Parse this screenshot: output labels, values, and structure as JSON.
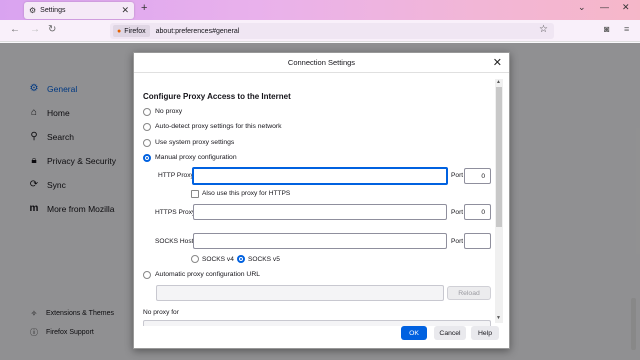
{
  "browser": {
    "tab_title": "Settings",
    "tab_icon": "gear-icon",
    "new_tab": "+",
    "identity_label": "Firefox",
    "url": "about:preferences#general"
  },
  "sidebar": {
    "items": [
      {
        "label": "General",
        "icon": "gear-icon",
        "active": true
      },
      {
        "label": "Home",
        "icon": "home-icon"
      },
      {
        "label": "Search",
        "icon": "search-icon"
      },
      {
        "label": "Privacy & Security",
        "icon": "lock-icon"
      },
      {
        "label": "Sync",
        "icon": "sync-icon"
      },
      {
        "label": "More from Mozilla",
        "icon": "mozilla-icon"
      }
    ],
    "footer": [
      {
        "label": "Extensions & Themes",
        "icon": "extensions-icon"
      },
      {
        "label": "Firefox Support",
        "icon": "help-icon"
      }
    ]
  },
  "dialog": {
    "title": "Connection Settings",
    "section_heading": "Configure Proxy Access to the Internet",
    "options": [
      {
        "label": "No proxy",
        "checked": false
      },
      {
        "label": "Auto-detect proxy settings for this network",
        "checked": false
      },
      {
        "label": "Use system proxy settings",
        "checked": false
      },
      {
        "label": "Manual proxy configuration",
        "checked": true
      }
    ],
    "http_proxy_label": "HTTP Proxy",
    "http_port_label": "Port",
    "http_port_value": "0",
    "https_checkbox_label": "Also use this proxy for HTTPS",
    "https_proxy_label": "HTTPS Proxy",
    "https_port_label": "Port",
    "https_port_value": "0",
    "socks_host_label": "SOCKS Host",
    "socks_port_label": "Port",
    "socks_port_value": "",
    "socks_v4_label": "SOCKS v4",
    "socks_v5_label": "SOCKS v5",
    "socks_version_selected": "SOCKS v5",
    "auto_config_label": "Automatic proxy configuration URL",
    "reload_label": "Reload",
    "no_proxy_label": "No proxy for",
    "ok_label": "OK",
    "cancel_label": "Cancel",
    "help_label": "Help"
  },
  "colors": {
    "accent": "#0061e0",
    "tabstrip_start": "#d9a3f0",
    "tabstrip_end": "#f6b7c9"
  }
}
